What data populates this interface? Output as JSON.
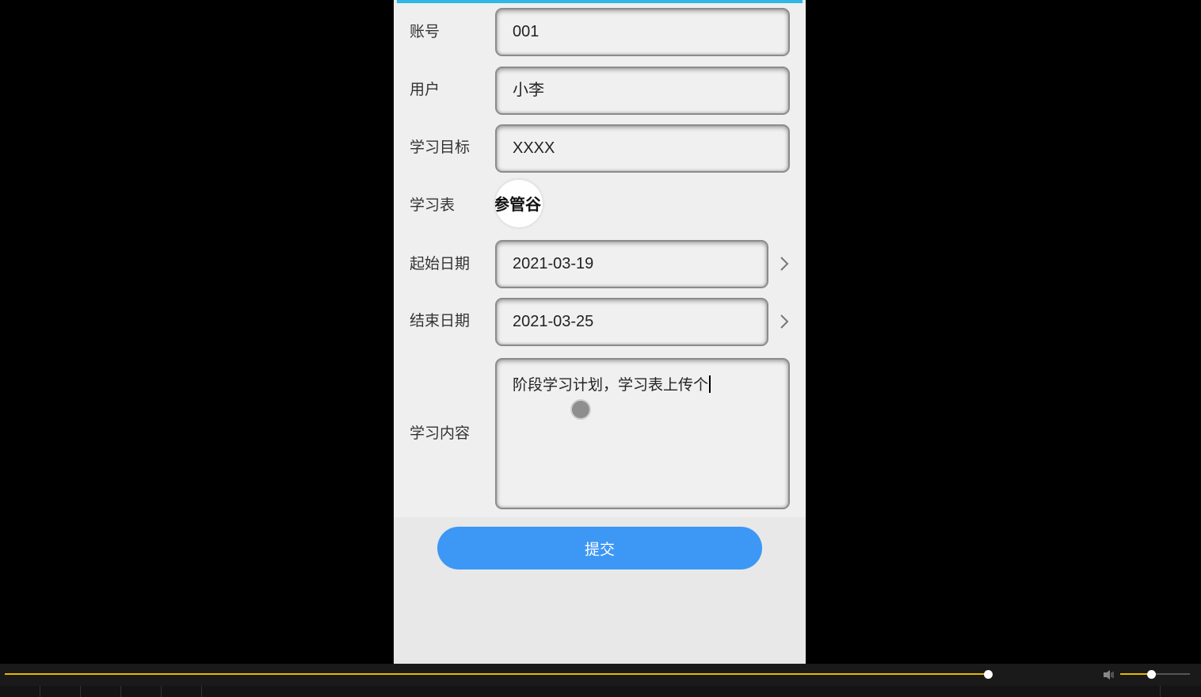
{
  "form": {
    "account": {
      "label": "账号",
      "value": "001"
    },
    "user": {
      "label": "用户",
      "value": "小李"
    },
    "goal": {
      "label": "学习目标",
      "value": "XXXX"
    },
    "sheet": {
      "label": "学习表",
      "thumbnail_text": "参管谷."
    },
    "start_date": {
      "label": "起始日期",
      "value": "2021-03-19"
    },
    "end_date": {
      "label": "结束日期",
      "value": "2021-03-25"
    },
    "content": {
      "label": "学习内容",
      "value": "阶段学习计划，学习表上传个"
    },
    "submit_label": "提交"
  },
  "player": {
    "progress": 0.905,
    "volume": 0.45
  },
  "colors": {
    "accent_bar": "#2eb8e6",
    "submit_bg": "#3d97f5",
    "progress": "#e6b800"
  },
  "icons": {
    "date_chevron": "chevron-right-icon",
    "volume": "speaker-icon"
  }
}
